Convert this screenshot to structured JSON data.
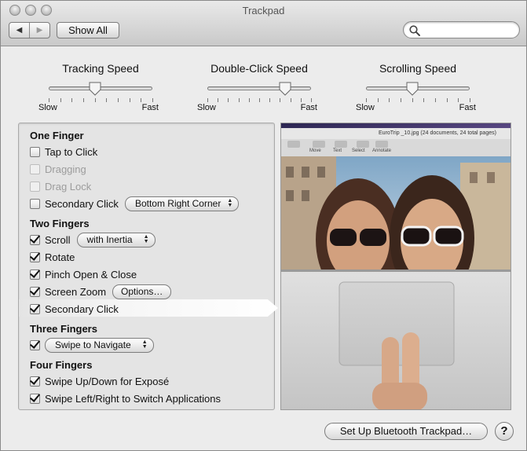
{
  "window": {
    "title": "Trackpad"
  },
  "toolbar": {
    "back_icon": "◀",
    "forward_icon": "▶",
    "show_all_label": "Show All",
    "search_value": "",
    "search_placeholder": ""
  },
  "sliders": [
    {
      "title": "Tracking Speed",
      "min_label": "Slow",
      "max_label": "Fast",
      "value": 0.45,
      "ticks": 10
    },
    {
      "title": "Double-Click Speed",
      "min_label": "Slow",
      "max_label": "Fast",
      "value": 0.75,
      "ticks": 11
    },
    {
      "title": "Scrolling Speed",
      "min_label": "Slow",
      "max_label": "Fast",
      "value": 0.45,
      "ticks": 10
    }
  ],
  "one_finger": {
    "heading": "One Finger",
    "tap_to_click": {
      "label": "Tap to Click",
      "checked": false
    },
    "dragging": {
      "label": "Dragging",
      "checked": false,
      "disabled": true
    },
    "drag_lock": {
      "label": "Drag Lock",
      "checked": false,
      "disabled": true
    },
    "secondary_click": {
      "label": "Secondary Click",
      "checked": false,
      "option": "Bottom Right Corner"
    }
  },
  "two_fingers": {
    "heading": "Two Fingers",
    "scroll": {
      "label": "Scroll",
      "checked": true,
      "option": "with Inertia"
    },
    "rotate": {
      "label": "Rotate",
      "checked": true
    },
    "pinch": {
      "label": "Pinch Open & Close",
      "checked": true
    },
    "screen_zoom": {
      "label": "Screen Zoom",
      "checked": true,
      "button": "Options…"
    },
    "secondary_click": {
      "label": "Secondary Click",
      "checked": true
    }
  },
  "three_fingers": {
    "heading": "Three Fingers",
    "swipe": {
      "checked": true,
      "option": "Swipe to Navigate"
    }
  },
  "four_fingers": {
    "heading": "Four Fingers",
    "expose": {
      "label": "Swipe Up/Down for Exposé",
      "checked": true
    },
    "switch_apps": {
      "label": "Swipe Left/Right to Switch Applications",
      "checked": true
    }
  },
  "preview": {
    "doc_title": "EuroTrip _10.jpg (24 documents, 24 total pages)",
    "toolbar_items": [
      "Move",
      "Text",
      "Select",
      "Annotate"
    ]
  },
  "footer": {
    "setup_label": "Set Up Bluetooth Trackpad…",
    "help_label": "?"
  },
  "colors": {
    "window_bg": "#ececec",
    "panel_bg": "#e4e4e4",
    "sky": "#8fb3cf",
    "laptop_silver": "#d2d2d2"
  }
}
